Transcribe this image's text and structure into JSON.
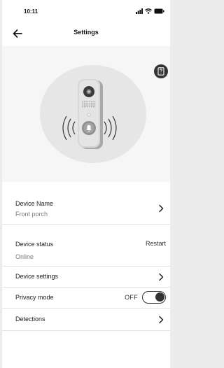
{
  "status_bar": {
    "time": "10:11",
    "icons": [
      "signal-icon",
      "wifi-icon",
      "battery-icon"
    ]
  },
  "header": {
    "title": "Settings",
    "back_icon": "arrow-left-icon",
    "help_icon": "manual-icon"
  },
  "hero": {
    "image": "doorbell-camera-illustration"
  },
  "rows": {
    "device_name": {
      "label": "Device Name",
      "value": "Front porch",
      "icon": "chevron-right-icon"
    },
    "device_status": {
      "label": "Device status",
      "value": "Online",
      "action": "Restart"
    },
    "device_settings": {
      "label": "Device settings",
      "icon": "chevron-right-icon"
    },
    "privacy_mode": {
      "label": "Privacy mode",
      "state_label": "OFF",
      "enabled": false
    },
    "detections": {
      "label": "Detections",
      "icon": "chevron-right-icon"
    }
  },
  "colors": {
    "background": "#ffffff",
    "hero_background": "#f6f6f6",
    "circle": "#e6e6e6",
    "text": "#1c1c1c",
    "subtext": "#7a7a7a",
    "toggle": "#333333"
  }
}
